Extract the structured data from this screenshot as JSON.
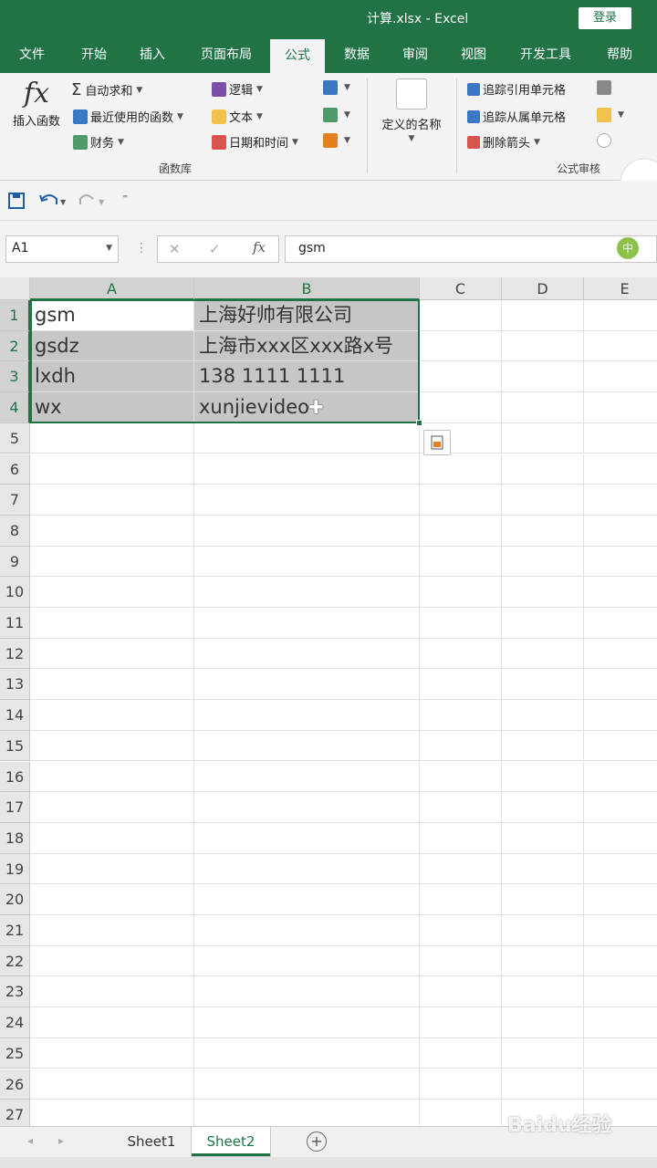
{
  "window": {
    "title": "计算.xlsx  -  Excel",
    "login_label": "登录",
    "accent": "#217346"
  },
  "tabs": [
    {
      "label": "文件"
    },
    {
      "label": "开始"
    },
    {
      "label": "插入"
    },
    {
      "label": "页面布局"
    },
    {
      "label": "公式",
      "active": true
    },
    {
      "label": "数据"
    },
    {
      "label": "审阅"
    },
    {
      "label": "视图"
    },
    {
      "label": "开发工具"
    },
    {
      "label": "帮助"
    }
  ],
  "ribbon": {
    "insert_function": "插入函数",
    "autosum": "自动求和",
    "recent": "最近使用的函数",
    "financial": "财务",
    "logical": "逻辑",
    "text": "文本",
    "datetime": "日期和时间",
    "function_library": "函数库",
    "defined_names": "定义的名称",
    "trace_precedents": "追踪引用单元格",
    "trace_dependents": "追踪从属单元格",
    "remove_arrows": "删除箭头",
    "formula_auditing": "公式审核",
    "fx_glyph": "fx"
  },
  "formula_bar": {
    "name_box": "A1",
    "formula": "gsm",
    "fx_glyph": "fx"
  },
  "grid": {
    "columns": [
      "A",
      "B",
      "C",
      "D",
      "E"
    ],
    "rows": [
      "1",
      "2",
      "3",
      "4",
      "5",
      "6",
      "7",
      "8",
      "9",
      "10",
      "11",
      "12",
      "13",
      "14",
      "15",
      "16",
      "17",
      "18",
      "19",
      "20",
      "21",
      "22",
      "23",
      "24",
      "25",
      "26",
      "27"
    ],
    "cells": [
      {
        "a": "gsm",
        "b": "上海好帅有限公司"
      },
      {
        "a": "gsdz",
        "b": "上海市xxx区xxx路x号"
      },
      {
        "a": "lxdh",
        "b": "138  1111  1111"
      },
      {
        "a": "wx",
        "b": "xunjievideo"
      }
    ]
  },
  "sheets": [
    {
      "label": "Sheet1"
    },
    {
      "label": "Sheet2",
      "active": true
    }
  ],
  "watermark": "Baidu经验"
}
